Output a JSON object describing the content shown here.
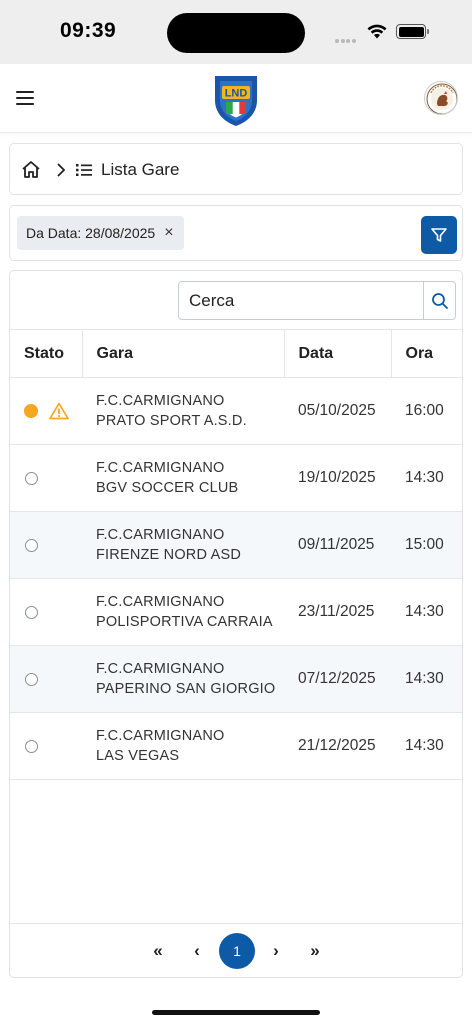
{
  "status_bar": {
    "time": "09:39"
  },
  "header": {
    "logo_text": "LND"
  },
  "breadcrumb": {
    "current": "Lista Gare"
  },
  "filter": {
    "chip_label": "Da Data: 28/08/2025",
    "chip_close": "×"
  },
  "search": {
    "placeholder": "Cerca"
  },
  "table": {
    "columns": [
      "Stato",
      "Gara",
      "Data",
      "Ora"
    ],
    "rows": [
      {
        "home": "F.C.CARMIGNANO",
        "away": "PRATO SPORT A.S.D.",
        "date": "05/10/2025",
        "time": "16:00",
        "status": "warning"
      },
      {
        "home": "F.C.CARMIGNANO",
        "away": "BGV SOCCER CLUB",
        "date": "19/10/2025",
        "time": "14:30",
        "status": "none"
      },
      {
        "home": "F.C.CARMIGNANO",
        "away": "FIRENZE NORD ASD",
        "date": "09/11/2025",
        "time": "15:00",
        "status": "none"
      },
      {
        "home": "F.C.CARMIGNANO",
        "away": "POLISPORTIVA CARRAIA",
        "date": "23/11/2025",
        "time": "14:30",
        "status": "none"
      },
      {
        "home": "F.C.CARMIGNANO",
        "away": "PAPERINO SAN GIORGIO",
        "date": "07/12/2025",
        "time": "14:30",
        "status": "none"
      },
      {
        "home": "F.C.CARMIGNANO",
        "away": "LAS VEGAS",
        "date": "21/12/2025",
        "time": "14:30",
        "status": "none"
      }
    ]
  },
  "pagination": {
    "first": "«",
    "prev": "‹",
    "current": "1",
    "next": "›",
    "last": "»"
  },
  "colors": {
    "primary": "#0d5aa7",
    "status_active": "#f5a623",
    "warning": "#f5a623"
  }
}
